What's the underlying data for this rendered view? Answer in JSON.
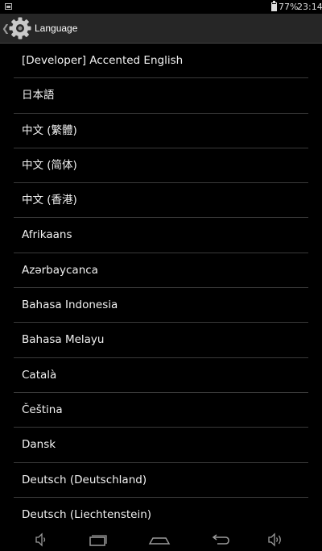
{
  "status_bar": {
    "battery": "77%",
    "time": "23:14"
  },
  "action_bar": {
    "title": "Language",
    "icon": "gear-icon"
  },
  "languages": [
    "[Developer] Accented English",
    "日本語",
    "中文 (繁體)",
    "中文 (简体)",
    "中文 (香港)",
    "Afrikaans",
    "Azərbaycanca",
    "Bahasa Indonesia",
    "Bahasa Melayu",
    "Català",
    "Čeština",
    "Dansk",
    "Deutsch (Deutschland)",
    "Deutsch (Liechtenstein)"
  ],
  "nav_bar": {
    "buttons": [
      "volume-down-icon",
      "recent-apps-icon",
      "home-icon",
      "back-icon",
      "volume-up-icon"
    ]
  },
  "colors": {
    "background": "#000000",
    "action_bar": "#262626",
    "divider": "#3a3a3a",
    "text": "#f2f2f2"
  }
}
